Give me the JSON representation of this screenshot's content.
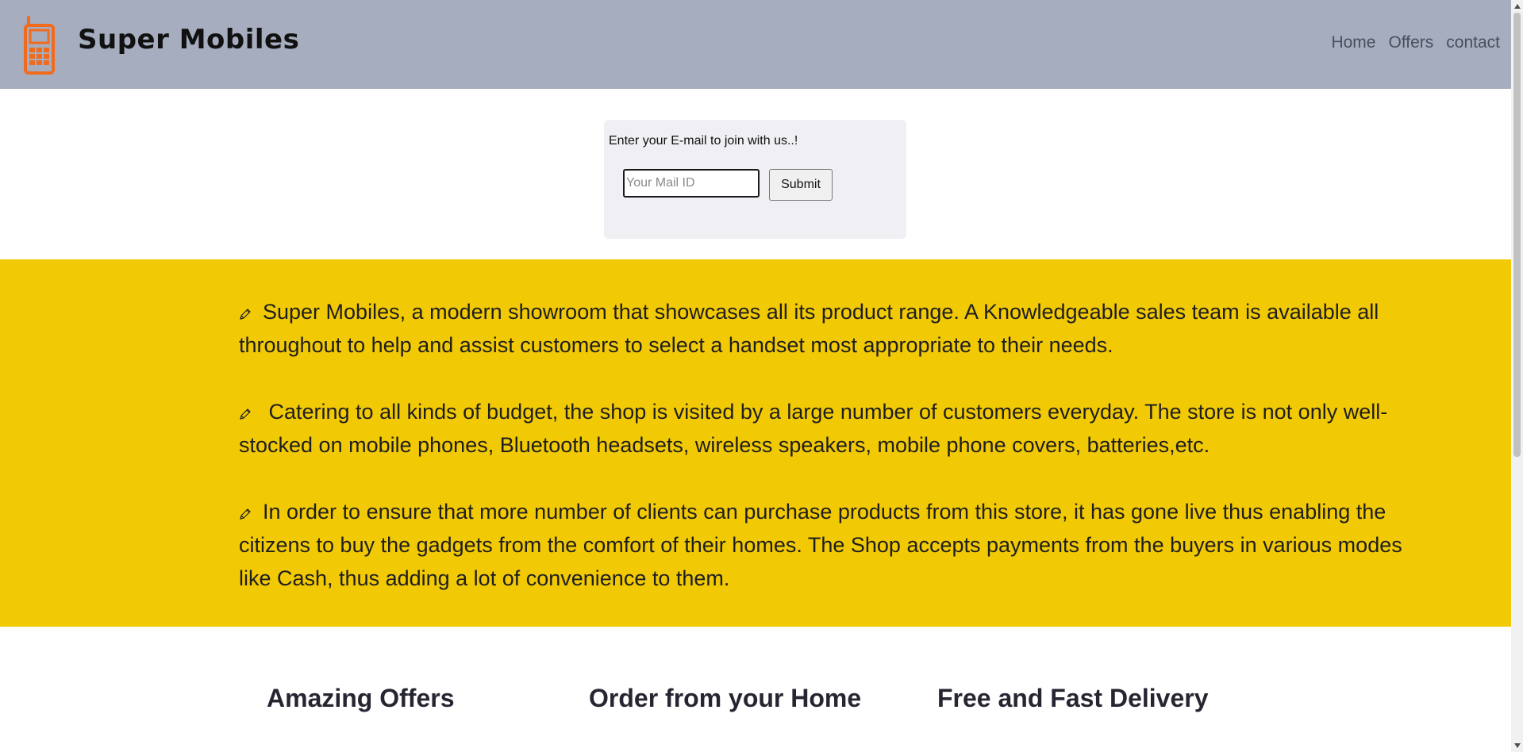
{
  "header": {
    "brand": "Super Mobiles",
    "logo_icon": "mobile-phone-icon",
    "nav": [
      {
        "label": "Home"
      },
      {
        "label": "Offers"
      },
      {
        "label": "contact"
      }
    ]
  },
  "subscribe": {
    "prompt": "Enter your E-mail to join with us..!",
    "email_placeholder": "Your Mail ID",
    "email_value": "",
    "submit_label": "Submit"
  },
  "about": {
    "bullet_icon": "pencil-icon",
    "paragraphs": [
      "Super Mobiles, a modern showroom that showcases all its product range. A Knowledgeable sales team is available all throughout to help and assist customers to select a handset most appropriate to their needs.",
      " Catering to all kinds of budget, the shop is visited by a large number of customers everyday. The store is not only well-stocked on mobile phones, Bluetooth headsets, wireless speakers, mobile phone covers, batteries,etc.",
      "In order to ensure that more number of clients can purchase products from this store, it has gone live thus enabling the citizens to buy the gadgets from the comfort of their homes. The Shop accepts payments from the buyers in various modes like Cash, thus adding a lot of convenience to them."
    ]
  },
  "features": [
    {
      "title": "Amazing Offers"
    },
    {
      "title": "Order from your Home"
    },
    {
      "title": "Free and Fast Delivery"
    }
  ],
  "colors": {
    "header_bg": "#a6adbe",
    "logo_orange": "#f26b1d",
    "about_bg": "#f2c905",
    "subscribe_bg": "#efeff4"
  }
}
